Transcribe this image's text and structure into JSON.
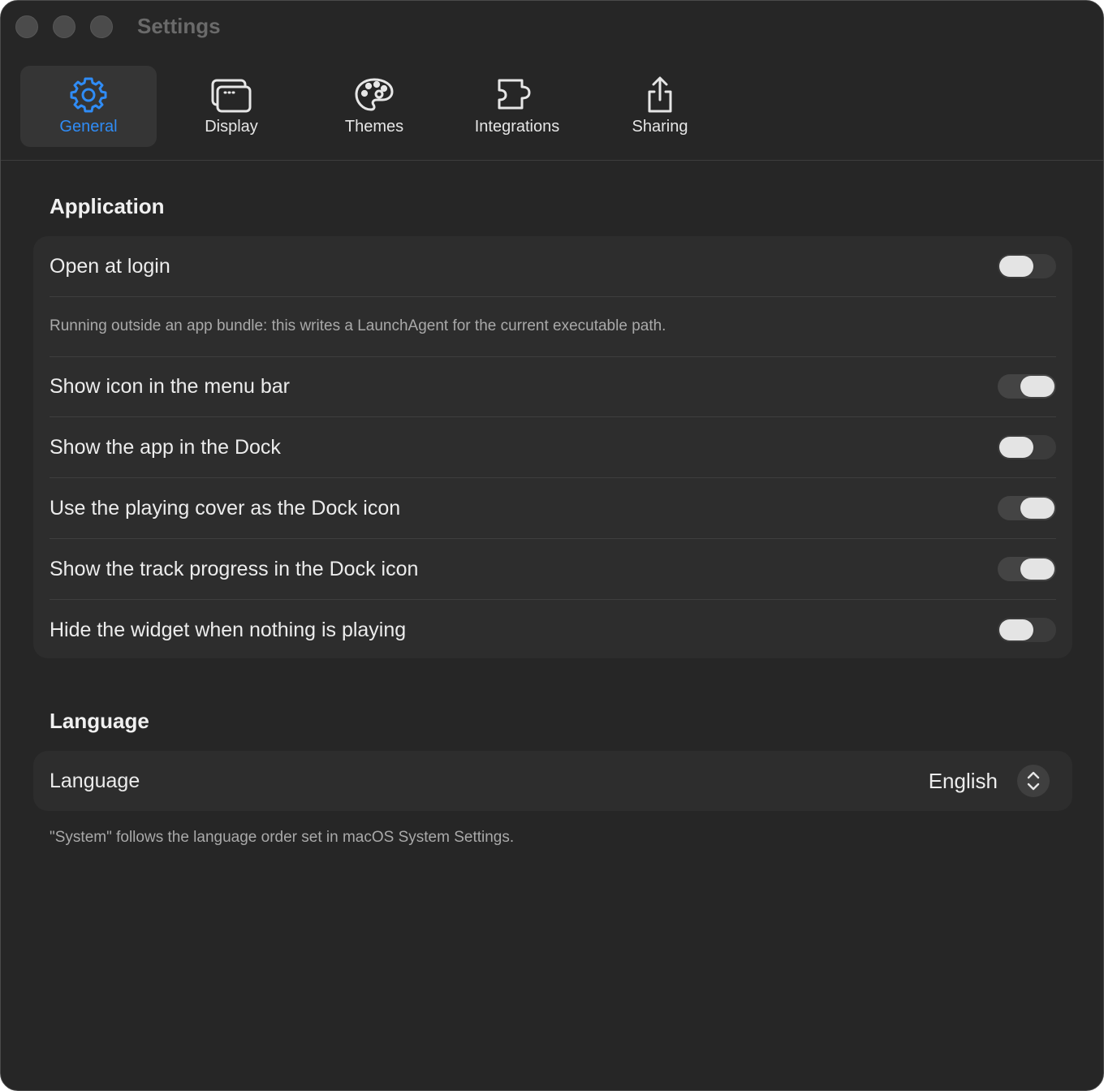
{
  "window": {
    "title": "Settings"
  },
  "toolbar": {
    "tabs": [
      {
        "label": "General",
        "icon": "gear-icon",
        "active": true
      },
      {
        "label": "Display",
        "icon": "display-icon",
        "active": false
      },
      {
        "label": "Themes",
        "icon": "palette-icon",
        "active": false
      },
      {
        "label": "Integrations",
        "icon": "puzzle-icon",
        "active": false
      },
      {
        "label": "Sharing",
        "icon": "share-icon",
        "active": false
      }
    ]
  },
  "application": {
    "title": "Application",
    "open_at_login": {
      "label": "Open at login",
      "value": false
    },
    "note": "Running outside an app bundle: this writes a LaunchAgent for the current executable path.",
    "show_menu_bar_icon": {
      "label": "Show icon in the menu bar",
      "value": true
    },
    "show_in_dock": {
      "label": "Show the app in the Dock",
      "value": false
    },
    "cover_as_dock_icon": {
      "label": "Use the playing cover as the Dock icon",
      "value": true
    },
    "track_progress_dock": {
      "label": "Show the track progress in the Dock icon",
      "value": true
    },
    "hide_widget_idle": {
      "label": "Hide the widget when nothing is playing",
      "value": false
    }
  },
  "language": {
    "title": "Language",
    "label": "Language",
    "value": "English",
    "footnote": "\"System\" follows the language order set in macOS System Settings."
  },
  "colors": {
    "window_bg": "#262626",
    "card_bg": "#2d2d2d",
    "accent": "#2f8cf6"
  }
}
